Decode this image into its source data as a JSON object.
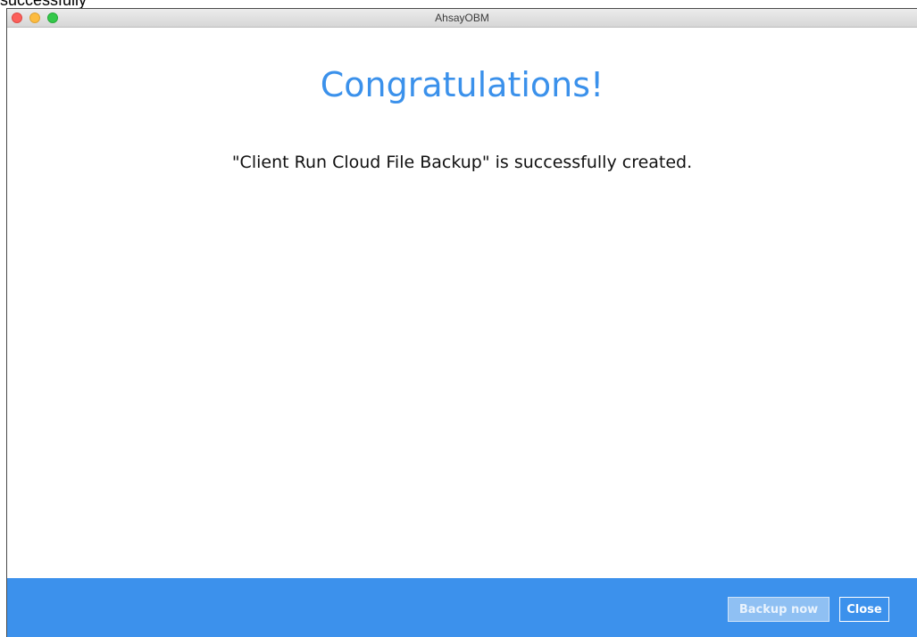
{
  "page": {
    "stray_text": "successfully"
  },
  "window": {
    "title": "AhsayOBM",
    "controls": [
      "close-icon",
      "minimize-icon",
      "maximize-icon"
    ]
  },
  "main": {
    "headline": "Congratulations!",
    "message": "\"Client Run Cloud File Backup\" is successfully created."
  },
  "footer": {
    "backup_now_label": "Backup now",
    "close_label": "Close"
  },
  "colors": {
    "accent": "#3c91ec",
    "headline": "#3b91eb",
    "disabled_button": "#8fc0f3"
  }
}
